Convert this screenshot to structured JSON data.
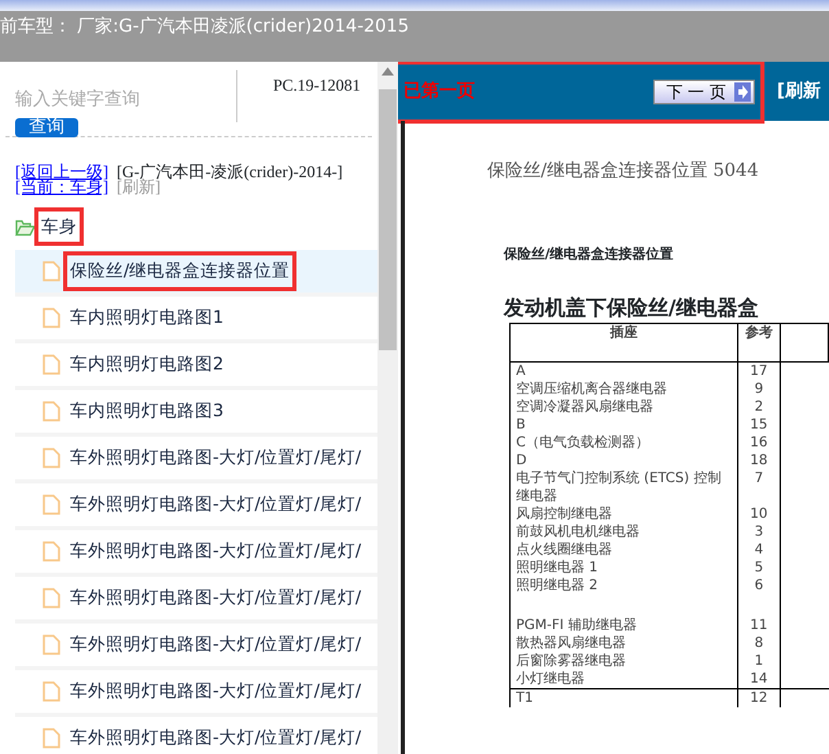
{
  "header": {
    "title": "前车型：  厂家:G-广汽本田凌派(crider)2014-2015"
  },
  "search": {
    "placeholder": "输入关键字查询",
    "button": "查询",
    "code": "PC.19-12081"
  },
  "breadcrumb": {
    "back": "[返回上一级]",
    "path": "[G-广汽本田-凌派(crider)-2014-]",
    "current": "[当前：车身]",
    "refresh": "[刷新]"
  },
  "tree": [
    {
      "label": "车身",
      "annotated": true,
      "expanded": true,
      "children": [
        {
          "label": "保险丝/继电器盒连接器位置",
          "selected": true,
          "annotated": true
        },
        {
          "label": "车内照明灯电路图1",
          "selected": false,
          "annotated": false
        },
        {
          "label": "车内照明灯电路图2",
          "selected": false,
          "annotated": false
        },
        {
          "label": "车内照明灯电路图3",
          "selected": false,
          "annotated": false
        },
        {
          "label": "车外照明灯电路图-大灯/位置灯/尾灯/",
          "selected": false,
          "annotated": false
        },
        {
          "label": "车外照明灯电路图-大灯/位置灯/尾灯/",
          "selected": false,
          "annotated": false
        },
        {
          "label": "车外照明灯电路图-大灯/位置灯/尾灯/",
          "selected": false,
          "annotated": false
        },
        {
          "label": "车外照明灯电路图-大灯/位置灯/尾灯/",
          "selected": false,
          "annotated": false
        },
        {
          "label": "车外照明灯电路图-大灯/位置灯/尾灯/",
          "selected": false,
          "annotated": false
        },
        {
          "label": "车外照明灯电路图-大灯/位置灯/尾灯/",
          "selected": false,
          "annotated": false
        },
        {
          "label": "车外照明灯电路图-大灯/位置灯/尾灯/",
          "selected": false,
          "annotated": false
        }
      ]
    }
  ],
  "pager": {
    "status": "已第一页",
    "next": "下 一 页",
    "refresh": "[刷新",
    "annotated": true
  },
  "document": {
    "title": "保险丝/继电器盒连接器位置 5044",
    "subtitle": "保险丝/继电器盒连接器位置",
    "heading": "发动机盖下保险丝/继电器盒",
    "table": {
      "columns": [
        "插座",
        "参考"
      ],
      "rows": [
        {
          "socket": "A",
          "ref": "17",
          "gap_before": false
        },
        {
          "socket": "空调压缩机离合器继电器",
          "ref": "9",
          "gap_before": false
        },
        {
          "socket": "空调冷凝器风扇继电器",
          "ref": "2",
          "gap_before": false
        },
        {
          "socket": "B",
          "ref": "15",
          "gap_before": false
        },
        {
          "socket": "C（电气负载检测器）",
          "ref": "16",
          "gap_before": false
        },
        {
          "socket": "D",
          "ref": "18",
          "gap_before": false
        },
        {
          "socket": "电子节气门控制系统 (ETCS) 控制继电器",
          "ref": "7",
          "gap_before": false
        },
        {
          "socket": "风扇控制继电器",
          "ref": "10",
          "gap_before": false
        },
        {
          "socket": "前鼓风机电机继电器",
          "ref": "3",
          "gap_before": false
        },
        {
          "socket": "点火线圈继电器",
          "ref": "4",
          "gap_before": false
        },
        {
          "socket": "照明继电器 1",
          "ref": "5",
          "gap_before": false
        },
        {
          "socket": "照明继电器 2",
          "ref": "6",
          "gap_before": false
        },
        {
          "socket": "PGM-FI 辅助继电器",
          "ref": "11",
          "gap_before": true
        },
        {
          "socket": "散热器风扇继电器",
          "ref": "8",
          "gap_before": false
        },
        {
          "socket": "后窗除雾器继电器",
          "ref": "1",
          "gap_before": false
        },
        {
          "socket": "小灯继电器",
          "ref": "14",
          "gap_before": false
        },
        {
          "socket": "T1",
          "ref": "12",
          "gap_before": false
        }
      ]
    }
  }
}
